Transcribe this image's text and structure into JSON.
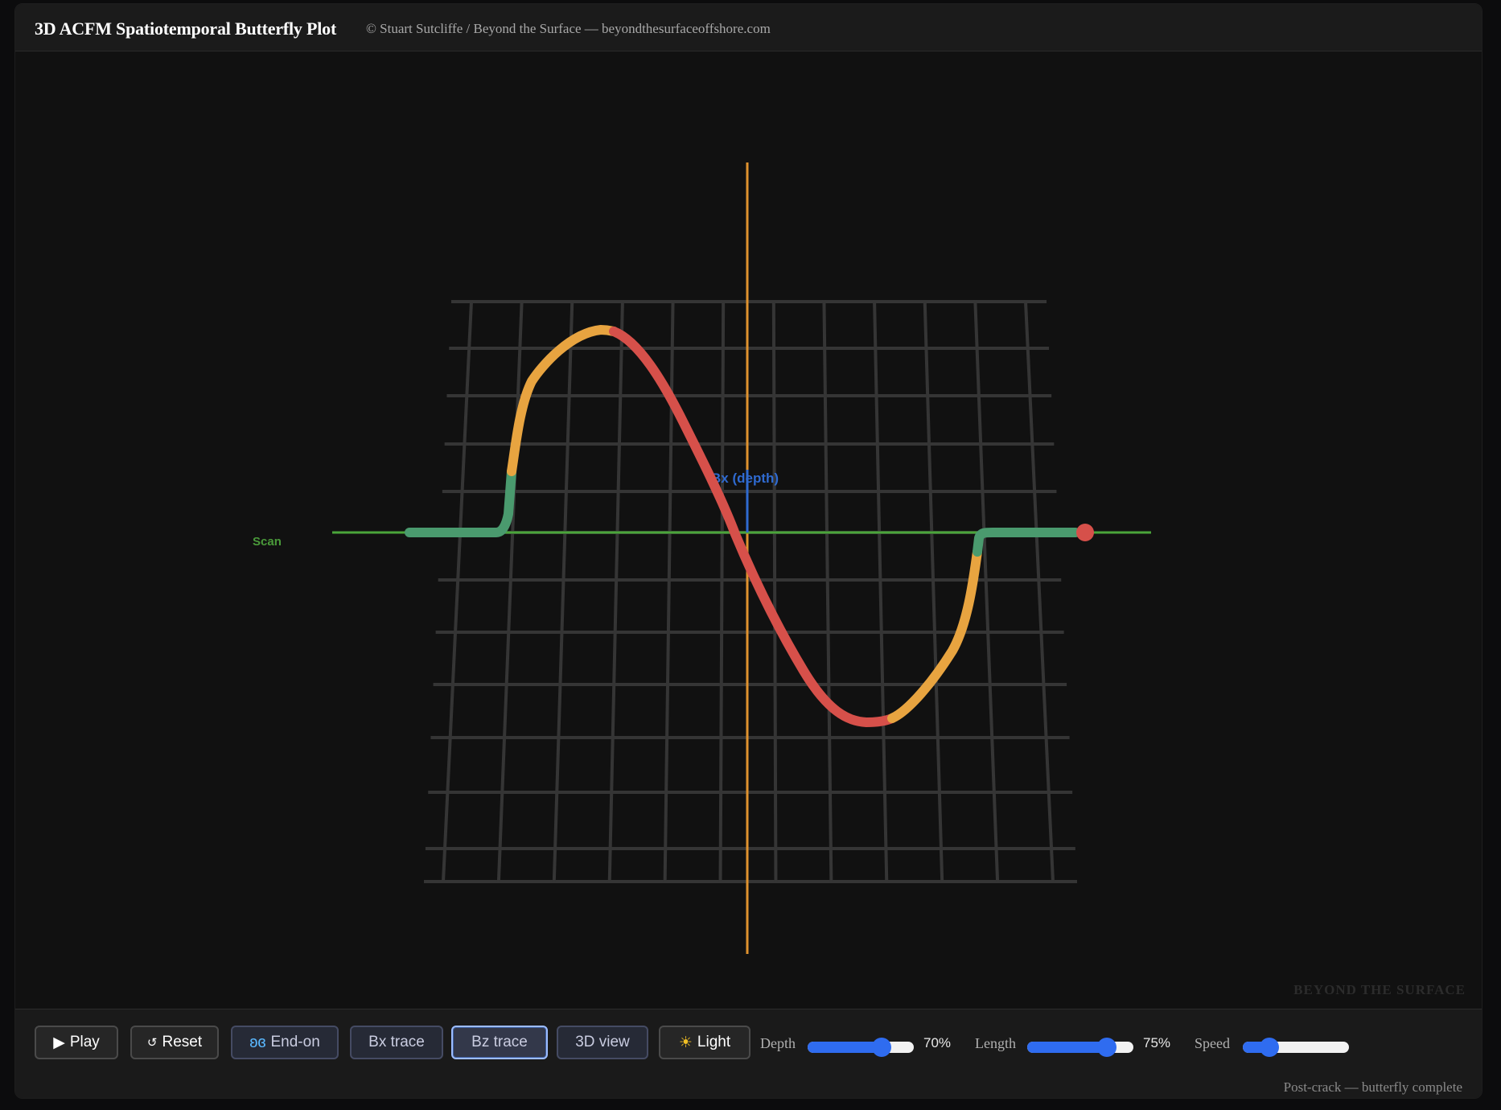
{
  "header": {
    "title": "3D ACFM Spatiotemporal Butterfly Plot",
    "subtitle": "© Stuart Sutcliffe / Beyond the Surface — beyondthesurfaceoffshore.com"
  },
  "plot": {
    "scan_label": "Scan",
    "bx_label": "Bx (depth)",
    "watermark": "BEYOND THE SURFACE",
    "colors": {
      "grid": "#353535",
      "scan_axis": "#4aa53a",
      "bz_axis": "#e0922e",
      "bx_axis": "#2f6ad0",
      "trace_green": "#4a9a6e",
      "trace_orange": "#e8a440",
      "trace_red": "#d6504a"
    }
  },
  "toolbar": {
    "play": "Play",
    "reset": "Reset",
    "end_on": "End-on",
    "bx_trace": "Bx trace",
    "bz_trace": "Bz trace",
    "view_3d": "3D view",
    "light": "Light",
    "active_button": "Bz trace",
    "depth": {
      "label": "Depth",
      "value": 70,
      "text": "70%"
    },
    "length": {
      "label": "Length",
      "value": 75,
      "text": "75%"
    },
    "speed": {
      "label": "Speed",
      "value": 25
    }
  },
  "status": "Post-crack — butterfly complete"
}
